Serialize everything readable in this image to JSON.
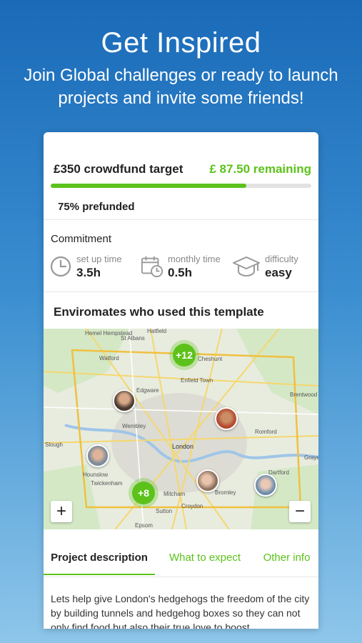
{
  "hero": {
    "title": "Get Inspired",
    "subtitle": "Join Global challenges or ready to launch projects and invite some friends!"
  },
  "funding": {
    "target_label": "£350 crowdfund target",
    "remaining_label": "£ 87.50 remaining",
    "progress_percent": 75,
    "prefunded_label": "75% prefunded",
    "accent_color": "#5cc21b"
  },
  "commitment": {
    "title": "Commitment",
    "stats": [
      {
        "icon": "clock-icon",
        "label": "set up time",
        "value": "3.5h"
      },
      {
        "icon": "calendar-clock-icon",
        "label": "monthly time",
        "value": "0.5h"
      },
      {
        "icon": "graduation-cap-icon",
        "label": "difficulty",
        "value": "easy"
      }
    ]
  },
  "map": {
    "title": "Enviromates who used this template",
    "clusters": [
      "+12",
      "+8"
    ],
    "places": [
      "Hemel Hempstead",
      "St Albans",
      "Hatfield",
      "Watford",
      "Edgware",
      "Cheshunt",
      "Enfield Town",
      "Wembley",
      "Romford",
      "Brentwood",
      "London",
      "Slough",
      "Hounslow",
      "Twickenham",
      "Mitcham",
      "Croydon",
      "Sutton",
      "Bromley",
      "Dartford",
      "Epsom",
      "Grays"
    ],
    "zoom_in": "+",
    "zoom_out": "−"
  },
  "tabs": [
    {
      "label": "Project description",
      "active": true
    },
    {
      "label": "What to expect",
      "active": false
    },
    {
      "label": "Other info",
      "active": false
    }
  ],
  "description": "Lets help give London's hedgehogs the freedom of the city by building tunnels and hedgehog boxes so they can not only find food but also their true love to boost"
}
